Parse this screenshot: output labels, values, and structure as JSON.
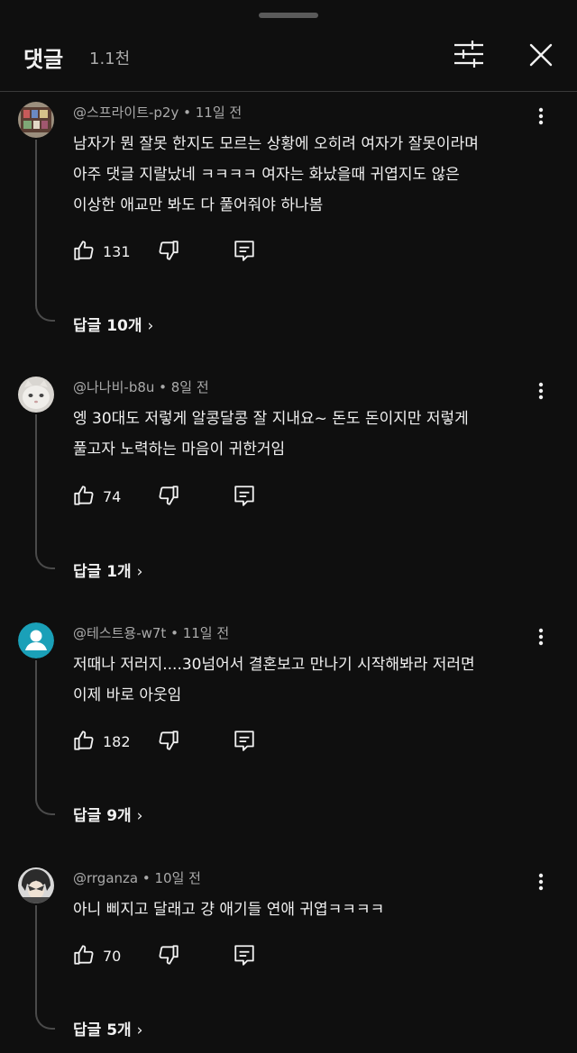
{
  "header": {
    "title": "댓글",
    "count": "1.1천"
  },
  "icons": {
    "filter": "sliders-icon",
    "close": "close-icon",
    "more": "more-vert-icon",
    "like": "thumbs-up-icon",
    "dislike": "thumbs-down-icon",
    "reply": "reply-icon",
    "chevron": "chevron-right-icon"
  },
  "comments": [
    {
      "meta": "@스프라이트-p2y • 11일 전",
      "text": "남자가 뭔 잘못 한지도 모르는 상황에 오히려 여자가 잘못이라며\n아주 댓글 지랄났네 ㅋㅋㅋㅋ 여자는 화났을때 귀엽지도 않은\n이상한 애교만 봐도 다 풀어줘야 하나봄",
      "likes": "131",
      "replies": "답글 10개"
    },
    {
      "meta": "@나나비-b8u • 8일 전",
      "text": "엥 30대도 저렇게 알콩달콩 잘 지내요~ 돈도 돈이지만 저렇게\n풀고자 노력하는 마음이 귀한거임",
      "likes": "74",
      "replies": "답글 1개"
    },
    {
      "meta": "@테스트용-w7t • 11일 전",
      "text": "저때나 저러지....30넘어서 결혼보고 만나기 시작해봐라 저러면\n이제 바로 아웃임",
      "likes": "182",
      "replies": "답글 9개"
    },
    {
      "meta": "@rrganza • 10일 전",
      "text": "아니 삐지고 달래고 걍 애기들 연애 귀엽ㅋㅋㅋㅋ",
      "likes": "70",
      "replies": "답글 5개"
    }
  ],
  "chevron": "›"
}
